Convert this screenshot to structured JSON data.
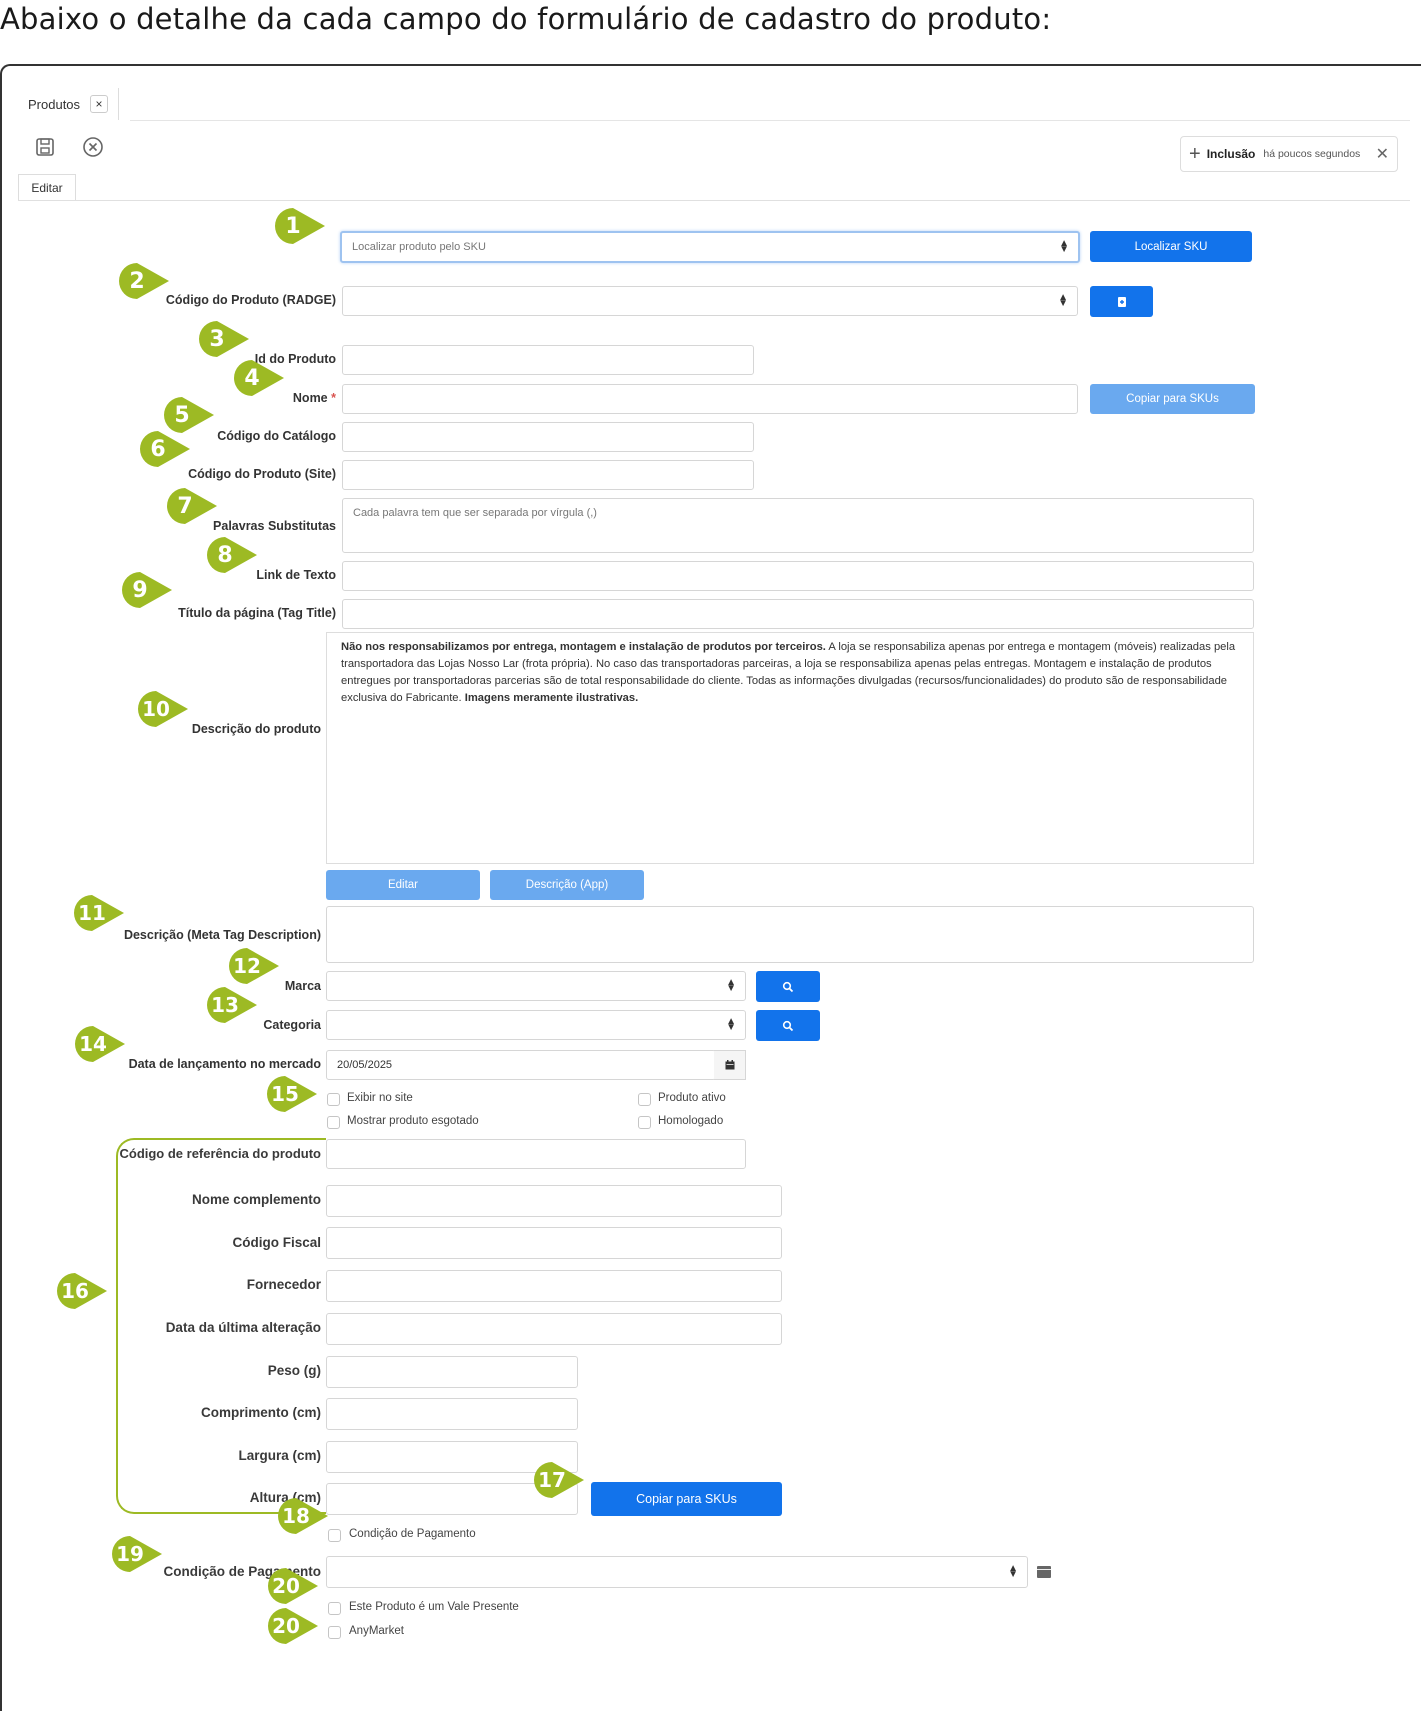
{
  "intro_text": "Abaixo o detalhe da cada campo do formulário de cadastro do produto:",
  "tab": {
    "label": "Produtos",
    "close": "×"
  },
  "toolbar": {
    "save_icon": "floppy-disk-icon",
    "cancel_icon": "circle-x-icon"
  },
  "notification": {
    "plus": "+",
    "title": "Inclusão",
    "time": "há poucos segundos",
    "close": "✕"
  },
  "subtab": "Editar",
  "fields": {
    "sku_search": {
      "placeholder": "Localizar produto pelo SKU",
      "button": "Localizar SKU"
    },
    "codigo_radge": {
      "label": "Código do Produto (RADGE)",
      "value": ""
    },
    "id_produto": {
      "label": "Id do Produto",
      "value": ""
    },
    "nome": {
      "label": "Nome",
      "required": "*",
      "value": "",
      "button": "Copiar para SKUs"
    },
    "codigo_catalogo": {
      "label": "Código do Catálogo",
      "value": ""
    },
    "codigo_site": {
      "label": "Código do Produto (Site)",
      "value": ""
    },
    "palavras": {
      "label": "Palavras Substitutas",
      "placeholder": "Cada palavra tem que ser separada por vírgula (,)"
    },
    "link_texto": {
      "label": "Link de Texto",
      "value": ""
    },
    "titulo": {
      "label": "Título da página (Tag Title)",
      "value": ""
    },
    "descricao": {
      "label": "Descrição do produto",
      "bold1": "Não nos responsabilizamos por entrega, montagem e instalação de produtos por terceiros.",
      "text1": " A loja se responsabiliza apenas por entrega e montagem (móveis) realizadas pela transportadora das Lojas Nosso Lar (frota própria). No caso das transportadoras parceiras, a loja se responsabiliza apenas pelas entregas. Montagem e instalação de produtos entregues por transportadoras parcerias são de total responsabilidade do cliente. Todas as informações divulgadas (recursos/funcionalidades) do produto são de responsabilidade exclusiva do Fabricante. ",
      "bold2": "Imagens meramente ilustrativas.",
      "btn_editar": "Editar",
      "btn_app": "Descrição (App)"
    },
    "meta_desc": {
      "label": "Descrição (Meta Tag Description)",
      "value": ""
    },
    "marca": {
      "label": "Marca",
      "value": ""
    },
    "categoria": {
      "label": "Categoria",
      "value": ""
    },
    "data_lancamento": {
      "label": "Data de lançamento no mercado",
      "value": "20/05/2025"
    },
    "checks": {
      "exibir": "Exibir no site",
      "ativo": "Produto ativo",
      "esgotado": "Mostrar produto esgotado",
      "homologado": "Homologado"
    },
    "ref": {
      "label": "Código de referência do produto"
    },
    "nome_complemento": {
      "label": "Nome complemento"
    },
    "codigo_fiscal": {
      "label": "Código Fiscal"
    },
    "fornecedor": {
      "label": "Fornecedor"
    },
    "data_alteracao": {
      "label": "Data da última alteração"
    },
    "peso": {
      "label": "Peso (g)"
    },
    "comprimento": {
      "label": "Comprimento (cm)"
    },
    "largura": {
      "label": "Largura (cm)"
    },
    "altura": {
      "label": "Altura (cm)",
      "button": "Copiar para SKUs"
    },
    "cond_pag_check": {
      "label": "Condição de Pagamento"
    },
    "cond_pag": {
      "label": "Condição de Pagamento",
      "value": ""
    },
    "vale_presente": {
      "label": "Este Produto é um Vale Presente"
    },
    "anymarket": {
      "label": "AnyMarket"
    }
  },
  "markers": [
    "1",
    "2",
    "3",
    "4",
    "5",
    "6",
    "7",
    "8",
    "9",
    "10",
    "11",
    "12",
    "13",
    "14",
    "15",
    "16",
    "17",
    "18",
    "19",
    "20",
    "20"
  ],
  "colors": {
    "marker": "#9dba24",
    "primary": "#1273eb",
    "primary_light": "#6aa9ef"
  }
}
